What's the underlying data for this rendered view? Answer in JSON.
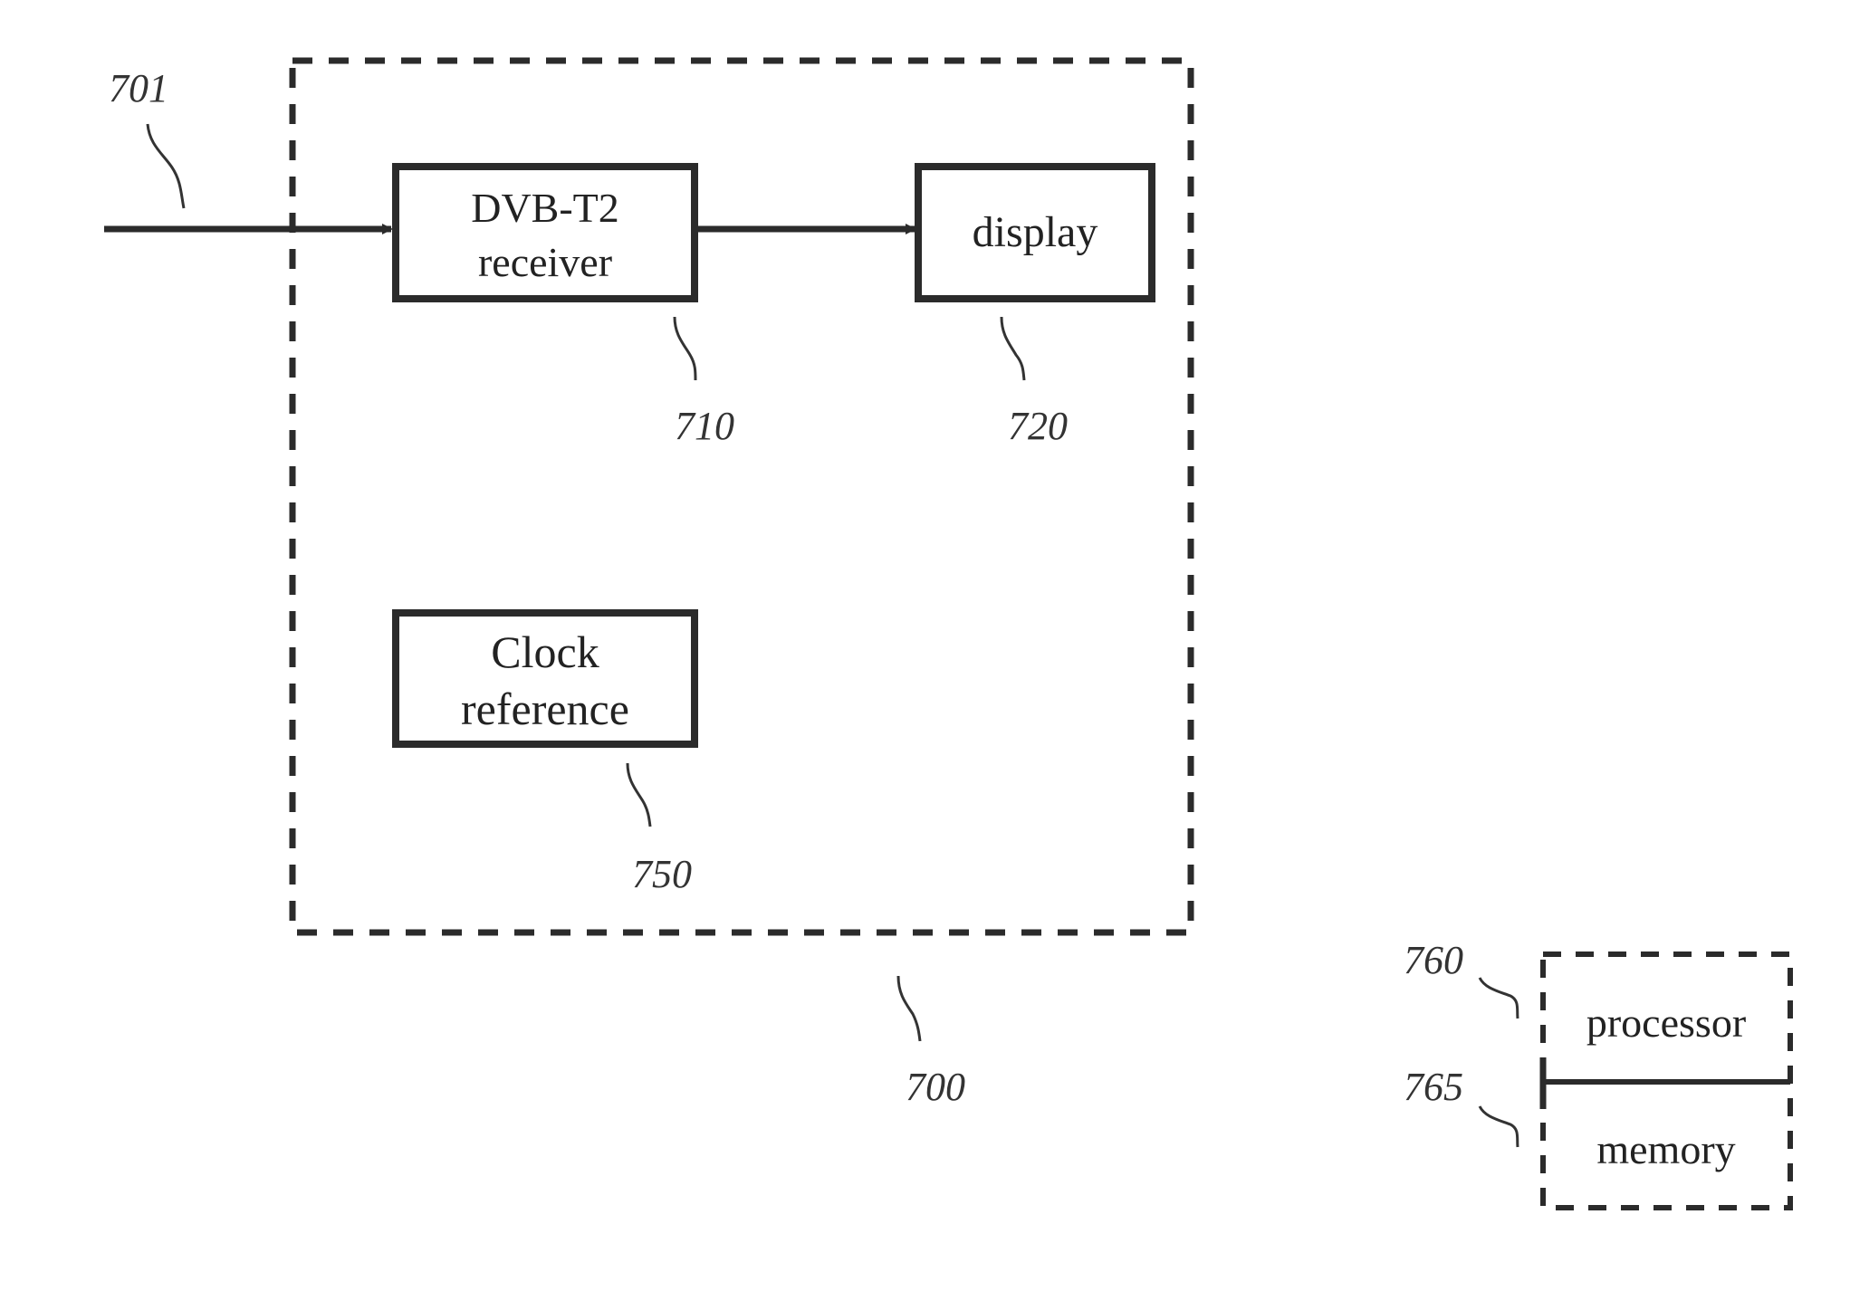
{
  "figure": {
    "outer_block": {
      "ref": "700"
    },
    "input_signal": {
      "ref": "701"
    },
    "blocks": [
      {
        "id": "receiver",
        "ref": "710",
        "lines": [
          "DVB-T2",
          "receiver"
        ]
      },
      {
        "id": "display",
        "ref": "720",
        "lines": [
          "display"
        ]
      },
      {
        "id": "clock",
        "ref": "750",
        "lines": [
          "Clock",
          "reference"
        ]
      }
    ],
    "computing_unit": {
      "processor": {
        "ref": "760",
        "label": "processor"
      },
      "memory": {
        "ref": "765",
        "label": "memory"
      }
    },
    "connections": [
      {
        "from": "input_signal",
        "to": "receiver"
      },
      {
        "from": "receiver",
        "to": "display"
      }
    ],
    "colors": {
      "stroke": "#2b2b2b",
      "text": "#222222",
      "background": "#ffffff"
    }
  }
}
